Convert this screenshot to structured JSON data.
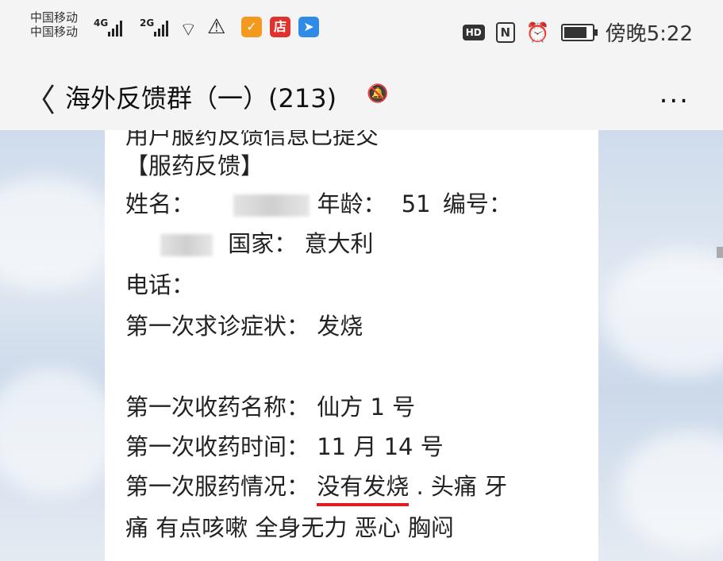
{
  "status_bar": {
    "carrier_1": "中国移动",
    "carrier_2": "中国移动",
    "network_1": "4G",
    "network_2": "2G",
    "hd": "HD",
    "nfc": "N",
    "time": "傍晚5:22",
    "app_icons": [
      "feather-app-icon",
      "store-app-icon",
      "flag-app-icon"
    ]
  },
  "header": {
    "back": "<",
    "title": "海外反馈群（一）(213)",
    "more": "..."
  },
  "message": {
    "truncated_top": "用户服药反馈信息已提交",
    "heading": "【服药反馈】",
    "name_label": "姓名：",
    "age_label": "年龄：",
    "age_value": "51",
    "id_label": "编号：",
    "country_label": "国家：",
    "country_value": "意大利",
    "phone_label": "电话：",
    "first_visit_label": "第一次求诊症状：",
    "first_visit_value": "发烧",
    "med_name_label": "第一次收药名称：",
    "med_name_value": "仙方 1 号",
    "med_time_label": "第一次收药时间：",
    "med_time_value": "11 月 14 号",
    "med_status_label": "第一次服药情况：",
    "med_status_highlight": "没有发烧",
    "med_status_rest": ". 头痛 牙",
    "med_status_line2": "痛 有点咳嗽 全身无力 恶心 胸闷"
  },
  "colors": {
    "highlight_underline": "#e01b1b",
    "feather_app": "#f39a1e",
    "store_app": "#e0332d",
    "flag_app": "#2f8be6"
  }
}
